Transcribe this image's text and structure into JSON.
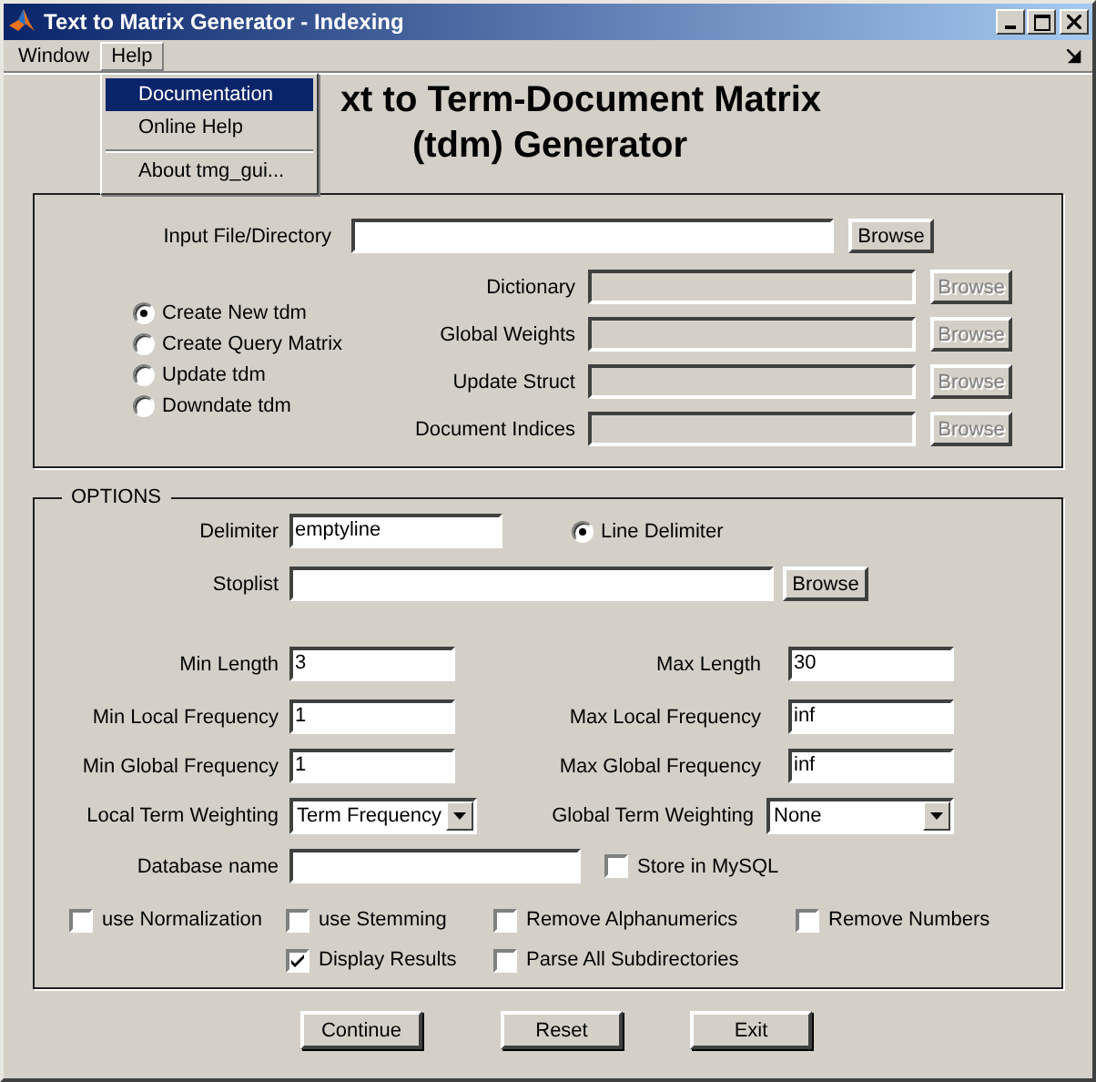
{
  "window": {
    "title": "Text to Matrix Generator - Indexing"
  },
  "menu": [
    {
      "label": "Window",
      "selected": false
    },
    {
      "label": "Help",
      "selected": true
    }
  ],
  "help_menu": {
    "items": [
      {
        "label": "Documentation",
        "selected": true,
        "separator_before": false
      },
      {
        "label": "Online Help",
        "selected": false,
        "separator_before": false
      },
      {
        "label": "About tmg_gui...",
        "selected": false,
        "separator_before": true
      }
    ]
  },
  "heading": [
    "xt to Term-Document Matrix",
    "(tdm) Generator"
  ],
  "input_file": {
    "label": "Input File/Directory",
    "button": "Browse"
  },
  "modes": [
    {
      "label": "Create New tdm",
      "selected": true
    },
    {
      "label": "Create Query Matrix",
      "selected": false
    },
    {
      "label": "Update tdm",
      "selected": false
    },
    {
      "label": "Downdate tdm",
      "selected": false
    }
  ],
  "auxiliary_fields": [
    {
      "label": "Dictionary",
      "button": "Browse",
      "disabled": true
    },
    {
      "label": "Global Weights",
      "button": "Browse",
      "disabled": true
    },
    {
      "label": "Update Struct",
      "button": "Browse",
      "disabled": true
    },
    {
      "label": "Document Indices",
      "button": "Browse",
      "disabled": true
    }
  ],
  "options": {
    "title": "OPTIONS",
    "delimiter": {
      "label": "Delimiter",
      "value": "emptyline"
    },
    "line_delimiter": {
      "label": "Line Delimiter",
      "selected": true
    },
    "stoplist": {
      "label": "Stoplist",
      "button": "Browse"
    },
    "numeric_rows": [
      {
        "left": {
          "label": "Min Length",
          "value": "3"
        },
        "right": {
          "label": "Max Length",
          "value": "30"
        }
      },
      {
        "left": {
          "label": "Min Local Frequency",
          "value": "1"
        },
        "right": {
          "label": "Max Local Frequency",
          "value": "inf"
        }
      },
      {
        "left": {
          "label": "Min Global Frequency",
          "value": "1"
        },
        "right": {
          "label": "Max Global Frequency",
          "value": "inf"
        }
      }
    ],
    "weighting": [
      {
        "label": "Local Term Weighting",
        "value": "Term Frequency"
      },
      {
        "label": "Global Term Weighting",
        "value": "None"
      }
    ],
    "database": {
      "label": "Database name"
    },
    "store_mysql": {
      "label": "Store in MySQL",
      "checked": false
    },
    "checkboxes": [
      {
        "label": "use Normalization",
        "checked": false
      },
      {
        "label": "use Stemming",
        "checked": false
      },
      {
        "label": "Remove Alphanumerics",
        "checked": false
      },
      {
        "label": "Remove Numbers",
        "checked": false
      },
      {
        "label": "Display Results",
        "checked": true
      },
      {
        "label": "Parse All Subdirectories",
        "checked": false
      }
    ]
  },
  "buttons": [
    "Continue",
    "Reset",
    "Exit"
  ]
}
